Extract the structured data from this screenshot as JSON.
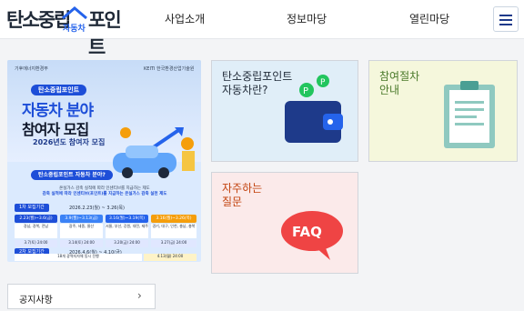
{
  "header": {
    "logo_text_left": "탄소중립",
    "logo_text_right": "포인트",
    "logo_sub": "자동차",
    "nav": [
      "사업소개",
      "정보마당",
      "열린마당"
    ],
    "menu_icon": "hamburger-icon"
  },
  "poster": {
    "org_left": "기후에너지환경부",
    "org_right": "KEITI 한국환경산업기술원",
    "pill": "탄소중립포인트",
    "headline_1": "자동차 분야",
    "headline_2": "참여자 모집",
    "year_line": "2026년도 참여자 모집",
    "question": "탄소중립포인트 자동차 분야?",
    "desc_1": "온실가스 감축 실적에 따라 인센티브를 지급하는 제도",
    "desc_2": "감축 실적에 따라 인센티브(포인트)를 지급하는 온실가스 감축 실천 제도",
    "round1_label": "1차 모집기간",
    "round1_dates": "2026.2.23(월) ~ 3.26(목)",
    "schedule": [
      {
        "date": "2.23(월)~3.6(금)",
        "regions": "경남, 경북, 전남"
      },
      {
        "date": "3.9(월)~3.13(금)",
        "regions": "광주, 세종, 울산"
      },
      {
        "date": "3.16(월)~3.19(목)",
        "regions": "서울, 부산, 강원, 대전, 제주"
      },
      {
        "date": "3.16(월)~3.26(목)",
        "regions": "경기, 대구, 인천, 충남, 충북"
      }
    ],
    "deadlines": [
      "3.7(토) 24:00",
      "3.14(토) 24:00",
      "3.20(금) 24:00",
      "3.27(금) 24:00"
    ],
    "round2_label": "2차 모집기간",
    "round2_dates": "2026.4.6(월) ~ 4.10(금)",
    "round2_regions": "18개 광역지자체 동시 진행",
    "round2_deadline": "4.13(월) 24:00"
  },
  "cards": [
    {
      "title_1": "탄소중립포인트",
      "title_2": "자동차란?",
      "icon": "wallet-icon"
    },
    {
      "title_1": "참여절차",
      "title_2": "안내",
      "icon": "clipboard-icon"
    },
    {
      "title_1": "자주하는",
      "title_2": "질문",
      "icon": "faq-bubble-icon",
      "badge": "FAQ"
    }
  ],
  "notice": {
    "label": "공지사항",
    "icon": "chevron-right-icon"
  },
  "colors": {
    "brand_blue": "#1d4ed8",
    "card1_bg": "#e0eef8",
    "card2_bg": "#f5f7dc",
    "card3_bg": "#fbeaea",
    "faq_red": "#ef4444"
  }
}
